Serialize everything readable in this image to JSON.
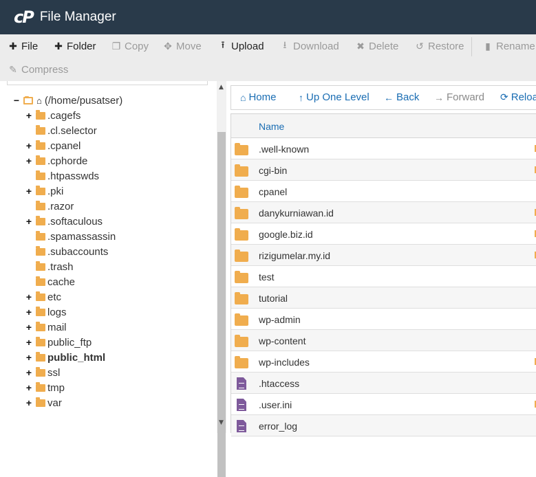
{
  "app": {
    "logo_text": "cP",
    "title": "File Manager"
  },
  "toolbar": {
    "file": "File",
    "folder": "Folder",
    "copy": "Copy",
    "move": "Move",
    "upload": "Upload",
    "download": "Download",
    "delete": "Delete",
    "restore": "Restore",
    "rename": "Rename",
    "compress": "Compress"
  },
  "tree": {
    "root": "(/home/pusatser)",
    "items": [
      {
        "label": ".cagefs",
        "expandable": true
      },
      {
        "label": ".cl.selector",
        "expandable": false
      },
      {
        "label": ".cpanel",
        "expandable": true
      },
      {
        "label": ".cphorde",
        "expandable": true
      },
      {
        "label": ".htpasswds",
        "expandable": false
      },
      {
        "label": ".pki",
        "expandable": true
      },
      {
        "label": ".razor",
        "expandable": false
      },
      {
        "label": ".softaculous",
        "expandable": true
      },
      {
        "label": ".spamassassin",
        "expandable": false
      },
      {
        "label": ".subaccounts",
        "expandable": false
      },
      {
        "label": ".trash",
        "expandable": false
      },
      {
        "label": "cache",
        "expandable": false
      },
      {
        "label": "etc",
        "expandable": true
      },
      {
        "label": "logs",
        "expandable": true
      },
      {
        "label": "mail",
        "expandable": true
      },
      {
        "label": "public_ftp",
        "expandable": true
      },
      {
        "label": "public_html",
        "expandable": true,
        "bold": true
      },
      {
        "label": "ssl",
        "expandable": true
      },
      {
        "label": "tmp",
        "expandable": true
      },
      {
        "label": "var",
        "expandable": true
      }
    ]
  },
  "nav": {
    "home": "Home",
    "up": "Up One Level",
    "back": "Back",
    "forward": "Forward",
    "reload": "Reload"
  },
  "table": {
    "name_header": "Name",
    "rows": [
      {
        "name": ".well-known",
        "type": "folder"
      },
      {
        "name": "cgi-bin",
        "type": "folder"
      },
      {
        "name": "cpanel",
        "type": "folder"
      },
      {
        "name": "danykurniawan.id",
        "type": "folder"
      },
      {
        "name": "google.biz.id",
        "type": "folder"
      },
      {
        "name": "rizigumelar.my.id",
        "type": "folder"
      },
      {
        "name": "test",
        "type": "folder"
      },
      {
        "name": "tutorial",
        "type": "folder"
      },
      {
        "name": "wp-admin",
        "type": "folder"
      },
      {
        "name": "wp-content",
        "type": "folder"
      },
      {
        "name": "wp-includes",
        "type": "folder"
      },
      {
        "name": ".htaccess",
        "type": "file"
      },
      {
        "name": ".user.ini",
        "type": "file"
      },
      {
        "name": "error_log",
        "type": "file"
      }
    ]
  },
  "colors": {
    "header_bg": "#293a4a",
    "link": "#1a6db3",
    "folder": "#f0ad4e",
    "file": "#7e5a9b"
  }
}
